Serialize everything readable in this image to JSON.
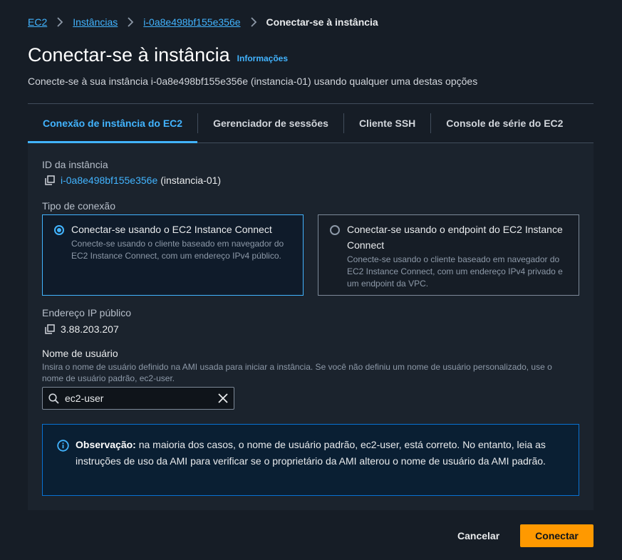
{
  "breadcrumb": {
    "items": [
      "EC2",
      "Instâncias",
      "i-0a8e498bf155e356e"
    ],
    "current": "Conectar-se à instância"
  },
  "header": {
    "title": "Conectar-se à instância",
    "info_link": "Informações",
    "subtitle": "Conecte-se à sua instância i-0a8e498bf155e356e (instancia-01) usando qualquer uma destas opções"
  },
  "tabs": [
    {
      "label": "Conexão de instância do EC2",
      "active": true
    },
    {
      "label": "Gerenciador de sessões",
      "active": false
    },
    {
      "label": "Cliente SSH",
      "active": false
    },
    {
      "label": "Console de série do EC2",
      "active": false
    }
  ],
  "instance": {
    "label": "ID da instância",
    "id": "i-0a8e498bf155e356e",
    "name": "(instancia-01)"
  },
  "connection_type": {
    "label": "Tipo de conexão",
    "options": [
      {
        "title": "Conectar-se usando o EC2 Instance Connect",
        "description": "Conecte-se usando o cliente baseado em navegador do EC2 Instance Connect, com um endereço IPv4 público.",
        "selected": true
      },
      {
        "title": "Conectar-se usando o endpoint do EC2 Instance Connect",
        "description": "Conecte-se usando o cliente baseado em navegador do EC2 Instance Connect, com um endereço IPv4 privado e um endpoint da VPC.",
        "selected": false
      }
    ]
  },
  "public_ip": {
    "label": "Endereço IP público",
    "value": "3.88.203.207"
  },
  "username": {
    "label": "Nome de usuário",
    "description": "Insira o nome de usuário definido na AMI usada para iniciar a instância. Se você não definiu um nome de usuário personalizado, use o nome de usuário padrão, ec2-user.",
    "value": "ec2-user"
  },
  "alert": {
    "bold": "Observação:",
    "text": " na maioria dos casos, o nome de usuário padrão, ec2-user, está correto. No entanto, leia as instruções de uso da AMI para verificar se o proprietário da AMI alterou o nome de usuário da AMI padrão."
  },
  "footer": {
    "cancel": "Cancelar",
    "connect": "Conectar"
  },
  "colors": {
    "background": "#161d26",
    "link": "#42b4ff",
    "primary_button": "#ff9900",
    "info_border": "#0972d3"
  }
}
